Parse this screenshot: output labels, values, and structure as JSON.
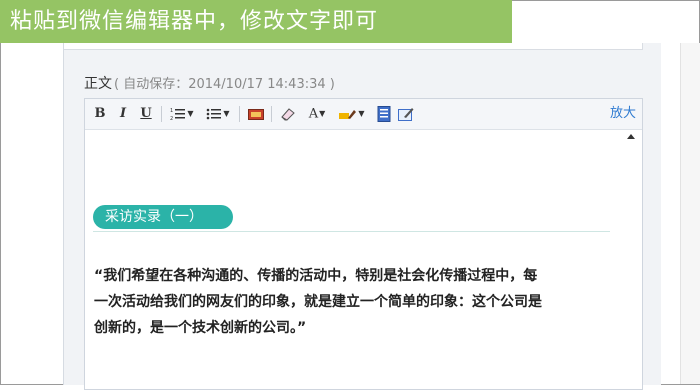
{
  "banner": {
    "text": "粘贴到微信编辑器中，修改文字即可"
  },
  "editor": {
    "label": "正文",
    "autosave": "( 自动保存：2014/10/17 14:43:34 )",
    "zoom_label": "放大",
    "toolbar": {
      "bold": "B",
      "italic": "I",
      "underline": "U",
      "font_color": "A"
    },
    "content": {
      "section_title": "采访实录（一）",
      "quote_lines": [
        "“我们希望在各种沟通的、传播的活动中，特别是社会化传播过程中，每",
        "一次活动给我们的网友们的印象，就是建立一个简单的印象：这个公司是",
        "创新的，是一个技术创新的公司。”"
      ]
    }
  },
  "colors": {
    "banner_bg": "#95c464",
    "pill_bg": "#2bb3a8",
    "link": "#2f7bd1"
  }
}
